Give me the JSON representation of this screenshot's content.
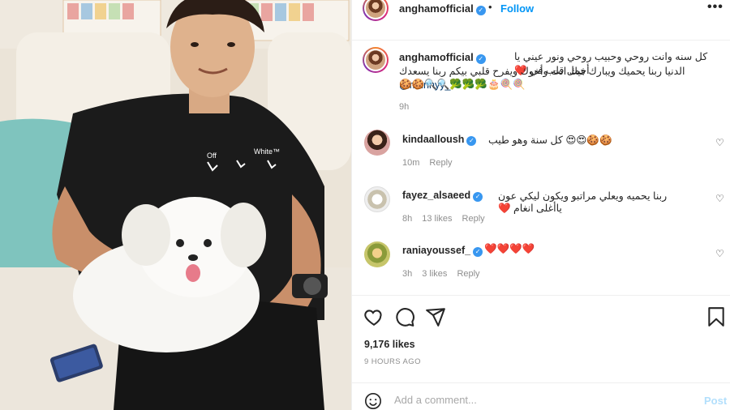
{
  "post": {
    "username": "anghamofficial",
    "follow_label": "Follow",
    "separator": "•",
    "more_label": "•••"
  },
  "caption": {
    "username": "anghamofficial",
    "line1": "كل سنه وانت روحي وحبيب روحي ونور عيني يا أجمل قلب في ❤️",
    "line2_mention": "@munnyy_",
    "line2_text": "الدنيا ربنا يحميك ويبارك فيك انت وأخوك ويفرح قلبي بيكم ربنا يسعدك",
    "line3": "🍪🍪🔍🔍🥦🥦🥦🎂🍭🍭",
    "time": "9h"
  },
  "comments": [
    {
      "username": "kindaalloush",
      "text": "🍪🍪😍😍 كل سنة وهو طيب",
      "time": "10m",
      "likes": "",
      "reply": "Reply"
    },
    {
      "username": "fayez_alsaeed",
      "text": "ربنا يحميه ويعلي مراتبو ويكون ليكي عون ياأغلى انغام ❤️",
      "time": "8h",
      "likes": "13 likes",
      "reply": "Reply"
    },
    {
      "username": "raniayoussef_",
      "text": "❤️❤️❤️❤️",
      "time": "3h",
      "likes": "3 likes",
      "reply": "Reply"
    }
  ],
  "stats": {
    "likes": "9,176 likes",
    "time_ago": "9 HOURS AGO"
  },
  "composer": {
    "placeholder": "Add a comment...",
    "post_label": "Post"
  },
  "colors": {
    "link_blue": "#0095f6",
    "post_disabled": "#b2dffc",
    "heart_red": "#ed4956",
    "verified_blue": "#3897f0",
    "sofa_cushion_teal": "#7fc4be",
    "shirt_black": "#1b1b1b"
  },
  "icons": [
    "heart-icon",
    "comment-icon",
    "share-icon",
    "bookmark-icon",
    "smiley-icon",
    "verified-icon",
    "more-icon"
  ]
}
